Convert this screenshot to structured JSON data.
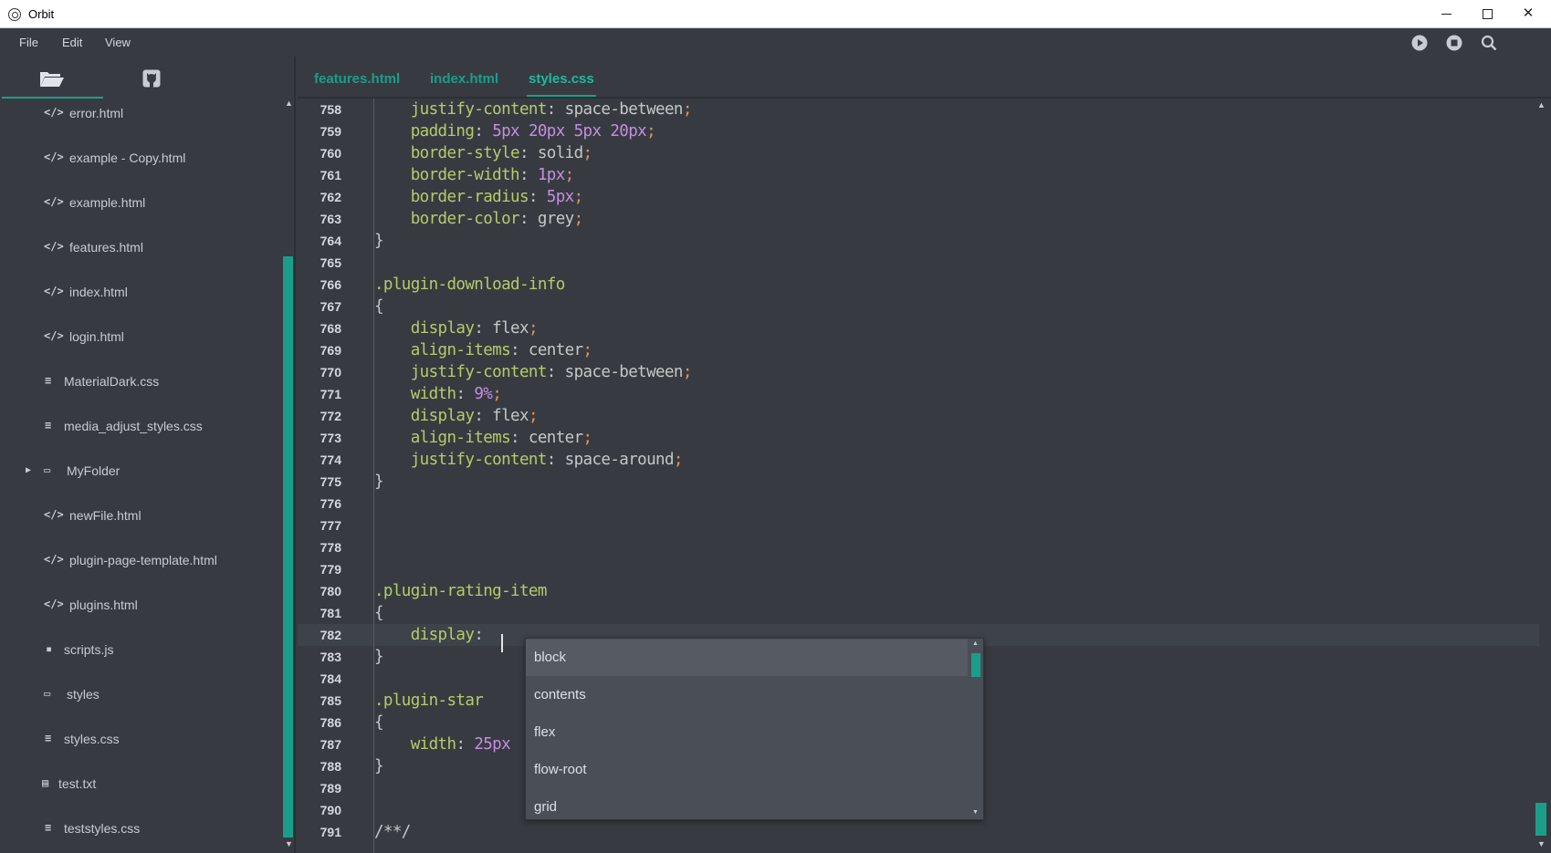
{
  "window": {
    "title": "Orbit"
  },
  "menu": {
    "items": [
      "File",
      "Edit",
      "View"
    ]
  },
  "toolbar": {
    "icons": [
      "play-icon",
      "stop-icon",
      "search-icon"
    ]
  },
  "sidebar": {
    "tabs": [
      "folder-open-icon",
      "github-icon"
    ],
    "files": [
      {
        "name": "error.html",
        "icon": "code"
      },
      {
        "name": "example - Copy.html",
        "icon": "code"
      },
      {
        "name": "example.html",
        "icon": "code"
      },
      {
        "name": "features.html",
        "icon": "code"
      },
      {
        "name": "index.html",
        "icon": "code"
      },
      {
        "name": "login.html",
        "icon": "code"
      },
      {
        "name": "MaterialDark.css",
        "icon": "css"
      },
      {
        "name": "media_adjust_styles.css",
        "icon": "css"
      },
      {
        "name": "MyFolder",
        "icon": "folder"
      },
      {
        "name": "newFile.html",
        "icon": "code"
      },
      {
        "name": "plugin-page-template.html",
        "icon": "code"
      },
      {
        "name": "plugins.html",
        "icon": "code"
      },
      {
        "name": "scripts.js",
        "icon": "js"
      },
      {
        "name": "styles",
        "icon": "folder"
      },
      {
        "name": "styles.css",
        "icon": "css"
      },
      {
        "name": "test.txt",
        "icon": "file"
      },
      {
        "name": "teststyles.css",
        "icon": "css"
      }
    ]
  },
  "editor": {
    "tabs": [
      "features.html",
      "index.html",
      "styles.css"
    ],
    "active_tab": "styles.css",
    "lines": [
      {
        "n": "758",
        "code": "    justify-content: space-between;"
      },
      {
        "n": "759",
        "code": "    padding: 5px 20px 5px 20px;"
      },
      {
        "n": "760",
        "code": "    border-style: solid;"
      },
      {
        "n": "761",
        "code": "    border-width: 1px;"
      },
      {
        "n": "762",
        "code": "    border-radius: 5px;"
      },
      {
        "n": "763",
        "code": "    border-color: grey;"
      },
      {
        "n": "764",
        "code": "}"
      },
      {
        "n": "765",
        "code": ""
      },
      {
        "n": "766",
        "code": ".plugin-download-info"
      },
      {
        "n": "767",
        "code": "{"
      },
      {
        "n": "768",
        "code": "    display: flex;"
      },
      {
        "n": "769",
        "code": "    align-items: center;"
      },
      {
        "n": "770",
        "code": "    justify-content: space-between;"
      },
      {
        "n": "771",
        "code": "    width: 9%;"
      },
      {
        "n": "772",
        "code": "    display: flex;"
      },
      {
        "n": "773",
        "code": "    align-items: center;"
      },
      {
        "n": "774",
        "code": "    justify-content: space-around;"
      },
      {
        "n": "775",
        "code": "}"
      },
      {
        "n": "776",
        "code": ""
      },
      {
        "n": "777",
        "code": ""
      },
      {
        "n": "778",
        "code": ""
      },
      {
        "n": "779",
        "code": ""
      },
      {
        "n": "780",
        "code": ".plugin-rating-item"
      },
      {
        "n": "781",
        "code": "{"
      },
      {
        "n": "782",
        "code": "    display: "
      },
      {
        "n": "783",
        "code": "}"
      },
      {
        "n": "784",
        "code": ""
      },
      {
        "n": "785",
        "code": ".plugin-star"
      },
      {
        "n": "786",
        "code": "{"
      },
      {
        "n": "787",
        "code": "    width: 25px"
      },
      {
        "n": "788",
        "code": "}"
      },
      {
        "n": "789",
        "code": ""
      },
      {
        "n": "790",
        "code": ""
      },
      {
        "n": "791",
        "code": "/**/"
      }
    ],
    "current_line": "782"
  },
  "autocomplete": {
    "options": [
      "block",
      "contents",
      "flex",
      "flow-root",
      "grid"
    ],
    "selected": "block"
  },
  "colors": {
    "accent": "#1a9e8a",
    "background": "#373b41",
    "property": "#b5cc6a",
    "number": "#c58ee0",
    "semicolon": "#de935f"
  }
}
